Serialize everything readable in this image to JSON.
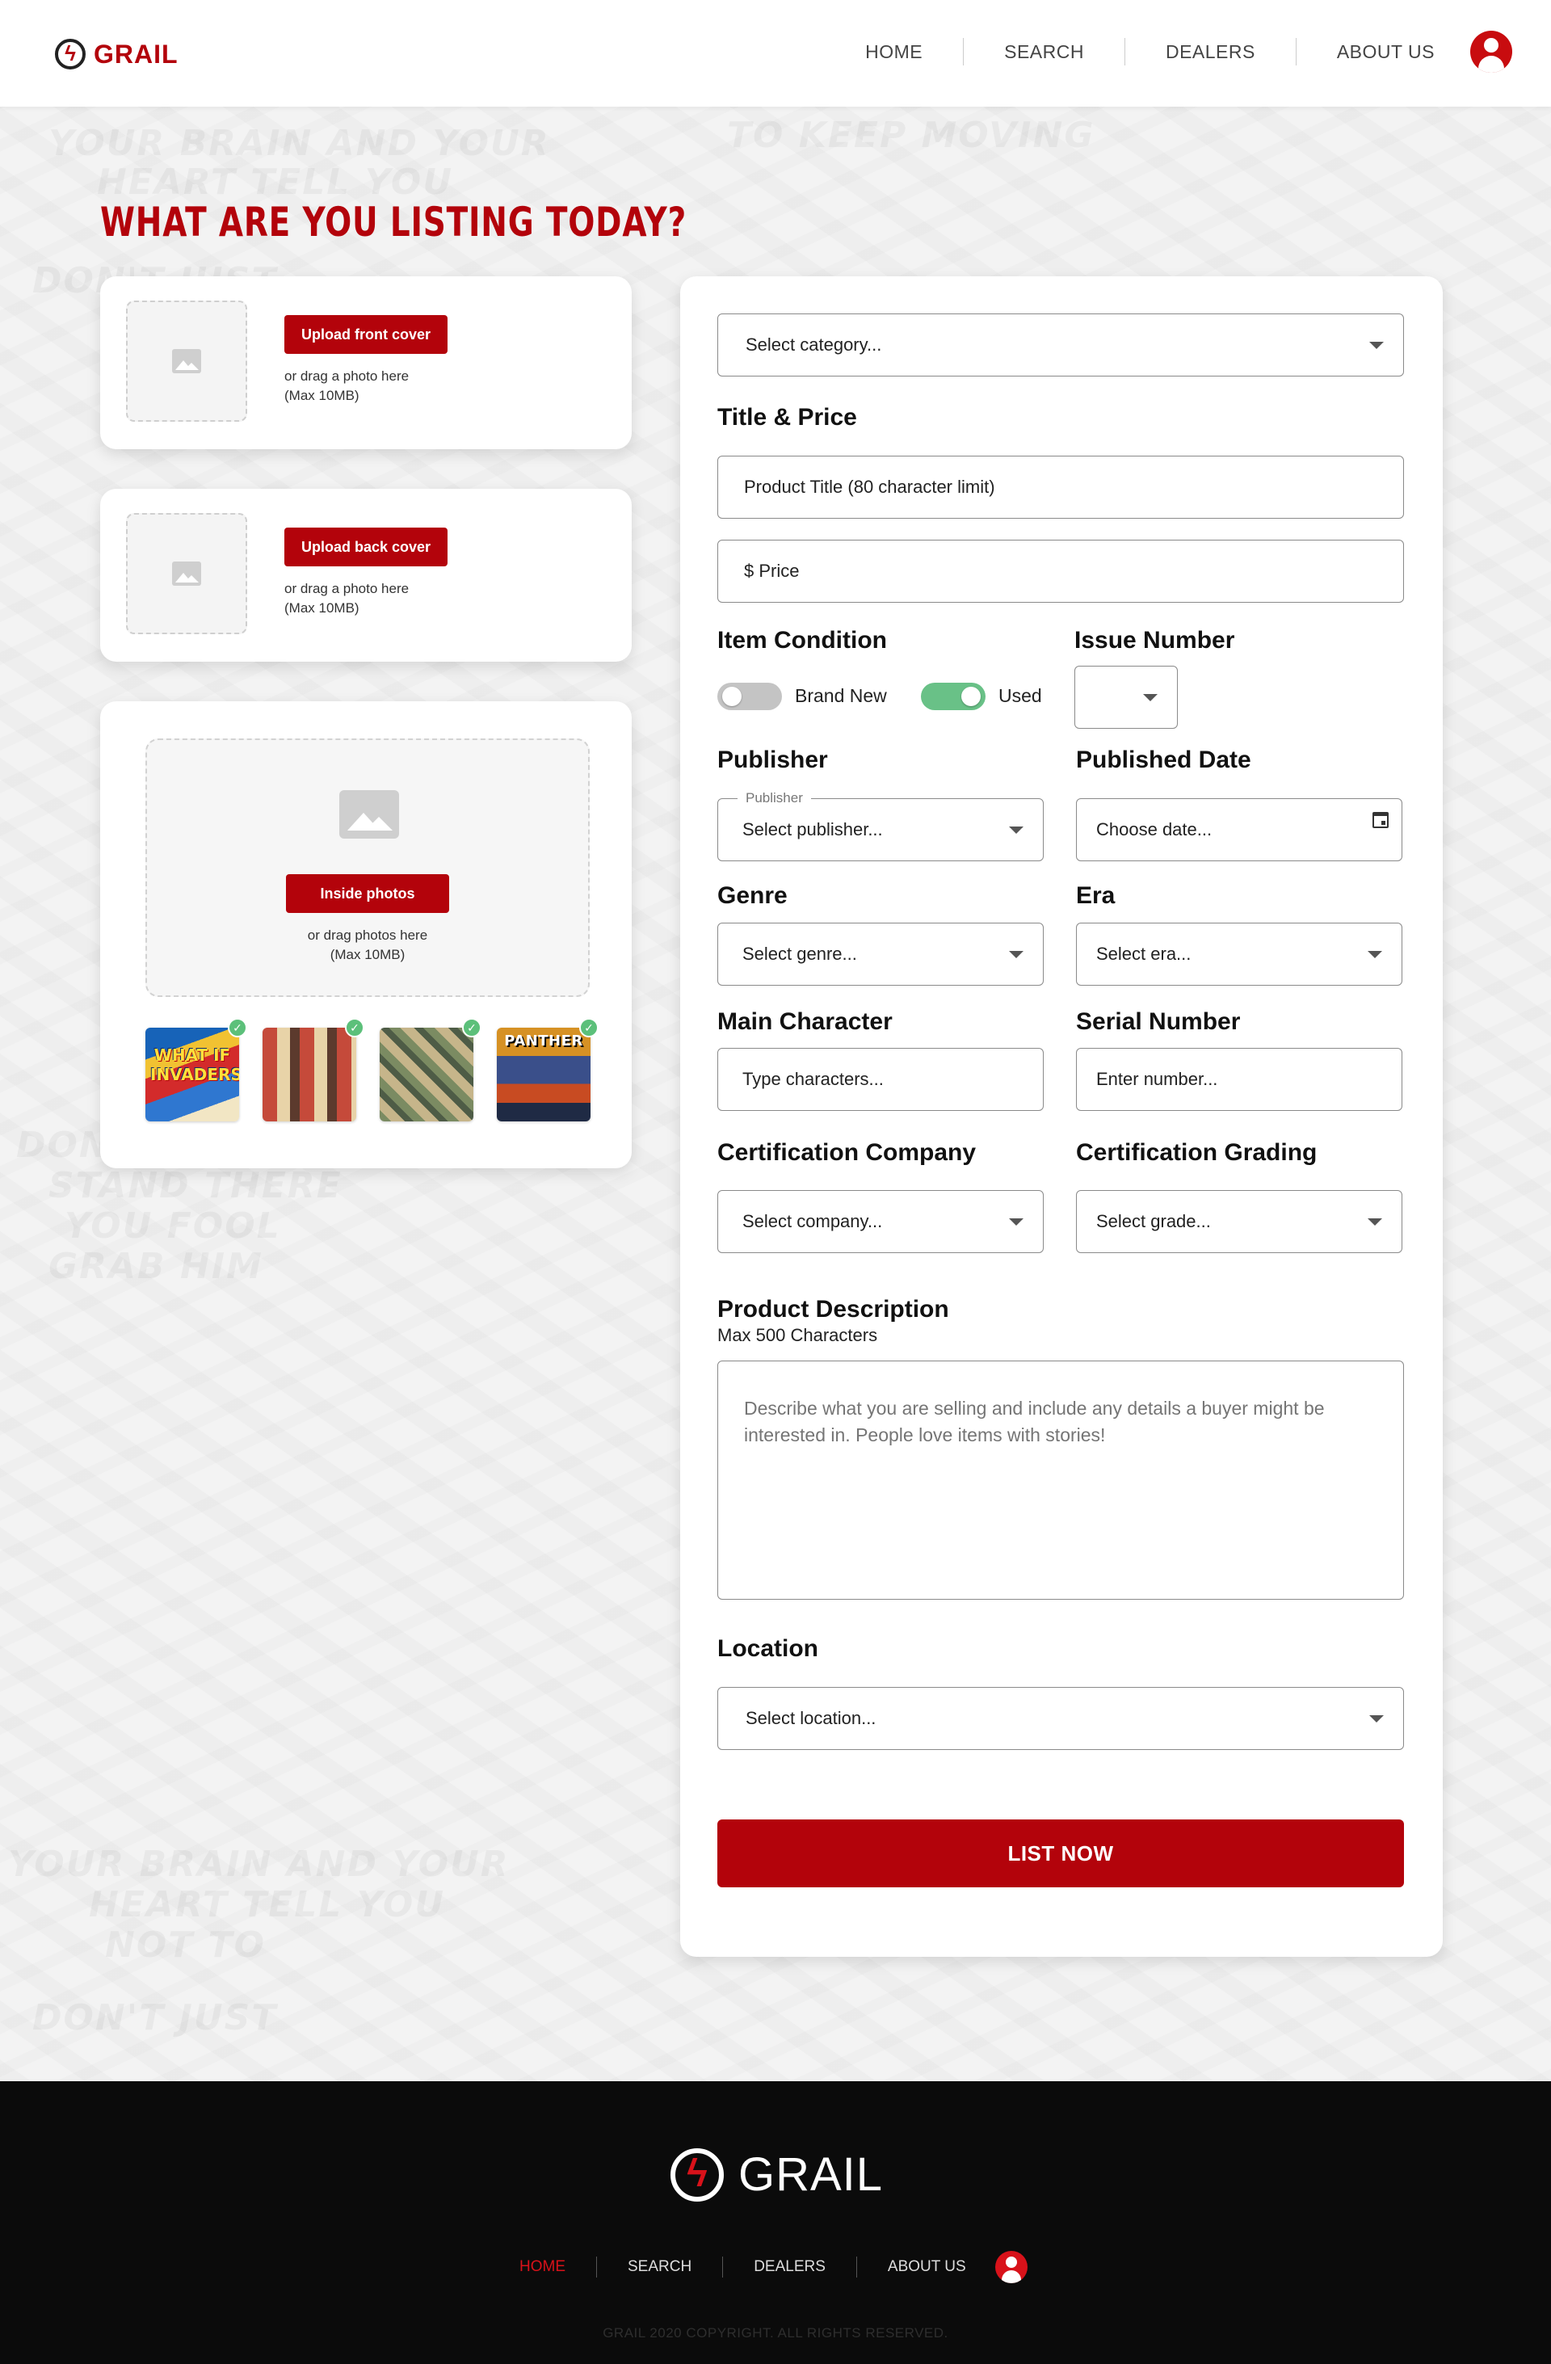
{
  "brand": {
    "name": "GRAIL",
    "accent": "#b3030b"
  },
  "nav": {
    "items": [
      {
        "label": "HOME"
      },
      {
        "label": "SEARCH"
      },
      {
        "label": "DEALERS"
      },
      {
        "label": "ABOUT US"
      }
    ]
  },
  "page": {
    "title": "WHAT ARE YOU LISTING TODAY?"
  },
  "uploads": {
    "front": {
      "button": "Upload front cover",
      "hint1": "or drag a photo here",
      "hint2": "(Max 10MB)"
    },
    "back": {
      "button": "Upload back cover",
      "hint1": "or drag a photo here",
      "hint2": "(Max 10MB)"
    },
    "inside": {
      "button": "Inside photos",
      "hint1": "or drag photos here",
      "hint2": "(Max 10MB)",
      "thumbnails": [
        {
          "title": "WHAT IF INVADERS",
          "selected": true,
          "icon": "check-icon"
        },
        {
          "title": "",
          "selected": true,
          "icon": "check-icon"
        },
        {
          "title": "",
          "selected": true,
          "icon": "check-icon"
        },
        {
          "title": "PANTHER",
          "selected": true,
          "icon": "check-icon"
        }
      ]
    }
  },
  "form": {
    "category": {
      "placeholder": "Select category..."
    },
    "title_price": {
      "label": "Title & Price",
      "title_placeholder": "Product Title (80 character limit)",
      "price_placeholder": "$ Price"
    },
    "condition": {
      "label": "Item Condition",
      "options": [
        {
          "label": "Brand New",
          "on": false
        },
        {
          "label": "Used",
          "on": true
        }
      ]
    },
    "issue_number": {
      "label": "Issue Number",
      "value": ""
    },
    "publisher": {
      "label": "Publisher",
      "legend": "Publisher",
      "placeholder": "Select publisher..."
    },
    "published_date": {
      "label": "Published Date",
      "placeholder": "Choose date..."
    },
    "genre": {
      "label": "Genre",
      "placeholder": "Select genre..."
    },
    "era": {
      "label": "Era",
      "placeholder": "Select era..."
    },
    "main_character": {
      "label": "Main Character",
      "placeholder": "Type characters..."
    },
    "serial_number": {
      "label": "Serial Number",
      "placeholder": "Enter number..."
    },
    "cert_company": {
      "label": "Certification Company",
      "placeholder": "Select company..."
    },
    "cert_grading": {
      "label": "Certification Grading",
      "placeholder": "Select grade..."
    },
    "description": {
      "label": "Product Description",
      "sublabel": "Max 500 Characters",
      "placeholder": "Describe what you are selling and include any details a buyer might be interested in. People love items with stories!"
    },
    "location": {
      "label": "Location",
      "placeholder": "Select location..."
    },
    "submit": "LIST NOW"
  },
  "footer": {
    "brand": "GRAIL",
    "nav": [
      {
        "label": "HOME",
        "active": true
      },
      {
        "label": "SEARCH",
        "active": false
      },
      {
        "label": "DEALERS",
        "active": false
      },
      {
        "label": "ABOUT US",
        "active": false
      }
    ],
    "copyright": "GRAIL 2020 COPYRIGHT. ALL RIGHTS RESERVED.",
    "active_color": "#d8121a"
  }
}
